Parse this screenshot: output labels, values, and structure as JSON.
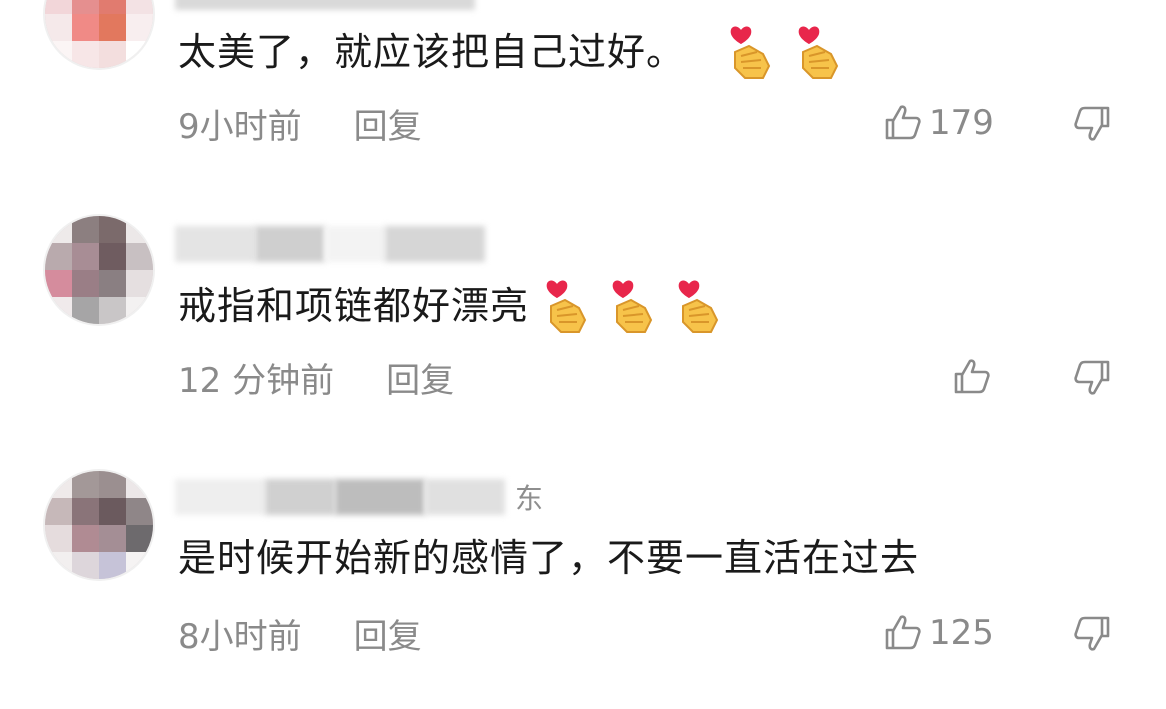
{
  "comments": [
    {
      "username_suffix": "",
      "text": "太美了，就应该把自己过好。",
      "emoji_count": 2,
      "time": "9小时前",
      "reply": "回复",
      "likes": "179"
    },
    {
      "username_suffix": "",
      "text": "戒指和项链都好漂亮",
      "emoji_count": 3,
      "time": "12 分钟前",
      "reply": "回复",
      "likes": ""
    },
    {
      "username_suffix": "东",
      "text": "是时候开始新的感情了，不要一直活在过去",
      "emoji_count": 0,
      "time": "8小时前",
      "reply": "回复",
      "likes": "125"
    }
  ],
  "icons": {
    "like": "thumbs-up-outline-icon",
    "dislike": "thumbs-down-outline-icon",
    "emoji": "finger-heart-emoji"
  },
  "colors": {
    "text_primary": "#1a1a1a",
    "text_secondary": "#8a8a8a",
    "emoji_hand": "#f7c34a",
    "emoji_heart": "#e8264b"
  }
}
